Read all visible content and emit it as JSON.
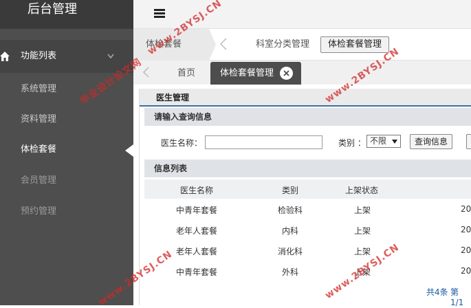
{
  "sidebar": {
    "brand": "后台管理",
    "group_label": "功能列表",
    "items": [
      {
        "label": "系统管理"
      },
      {
        "label": "资料管理"
      },
      {
        "label": "体检套餐"
      },
      {
        "label": "会员管理"
      },
      {
        "label": "预约管理"
      }
    ]
  },
  "breadcrumb": {
    "current": "体检套餐",
    "link": "科室分类管理",
    "active": "体检套餐管理"
  },
  "tabs": [
    {
      "label": "首页"
    },
    {
      "label": "体检套餐管理"
    }
  ],
  "panel": {
    "title": "医生管理",
    "query_header": "请输入查询信息",
    "name_label": "医生名称：",
    "name_value": "",
    "category_label": "类别 ：",
    "category_selected": "不限",
    "query_button": "查询信息",
    "list_header": "信息列表",
    "columns": [
      "医生名称",
      "类别",
      "上架状态"
    ],
    "rows": [
      {
        "name": "中青年套餐",
        "category": "检验科",
        "status": "上架",
        "extra": "20"
      },
      {
        "name": "老年人套餐",
        "category": "内科",
        "status": "上架",
        "extra": "20"
      },
      {
        "name": "老年人套餐",
        "category": "消化科",
        "status": "上架",
        "extra": "20"
      },
      {
        "name": "中青年套餐",
        "category": "外科",
        "status": "上架",
        "extra": "20"
      }
    ],
    "total": "共4条",
    "page": "第1/1"
  },
  "watermarks": [
    "www.2BYSJ.CN",
    "毕业设计论文网"
  ]
}
